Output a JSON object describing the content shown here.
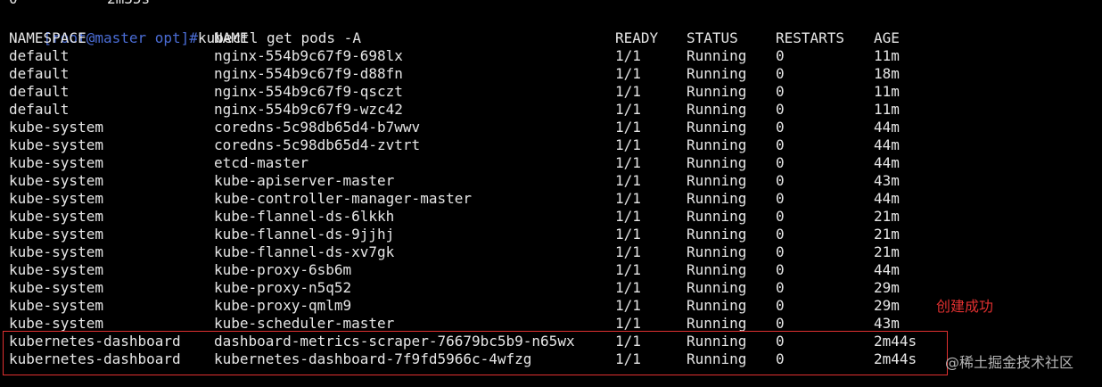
{
  "partial_top": {
    "col1": "0",
    "col2": "2m35s"
  },
  "prompt_text": "[root@master opt]#",
  "command": "kubectl get pods -A",
  "headers": {
    "namespace": "NAMESPACE",
    "name": "NAME",
    "ready": "READY",
    "status": "STATUS",
    "restarts": "RESTARTS",
    "age": "AGE"
  },
  "rows": [
    {
      "namespace": "default",
      "name": "nginx-554b9c67f9-698lx",
      "ready": "1/1",
      "status": "Running",
      "restarts": "0",
      "age": "11m"
    },
    {
      "namespace": "default",
      "name": "nginx-554b9c67f9-d88fn",
      "ready": "1/1",
      "status": "Running",
      "restarts": "0",
      "age": "18m"
    },
    {
      "namespace": "default",
      "name": "nginx-554b9c67f9-qsczt",
      "ready": "1/1",
      "status": "Running",
      "restarts": "0",
      "age": "11m"
    },
    {
      "namespace": "default",
      "name": "nginx-554b9c67f9-wzc42",
      "ready": "1/1",
      "status": "Running",
      "restarts": "0",
      "age": "11m"
    },
    {
      "namespace": "kube-system",
      "name": "coredns-5c98db65d4-b7wwv",
      "ready": "1/1",
      "status": "Running",
      "restarts": "0",
      "age": "44m"
    },
    {
      "namespace": "kube-system",
      "name": "coredns-5c98db65d4-zvtrt",
      "ready": "1/1",
      "status": "Running",
      "restarts": "0",
      "age": "44m"
    },
    {
      "namespace": "kube-system",
      "name": "etcd-master",
      "ready": "1/1",
      "status": "Running",
      "restarts": "0",
      "age": "44m"
    },
    {
      "namespace": "kube-system",
      "name": "kube-apiserver-master",
      "ready": "1/1",
      "status": "Running",
      "restarts": "0",
      "age": "43m"
    },
    {
      "namespace": "kube-system",
      "name": "kube-controller-manager-master",
      "ready": "1/1",
      "status": "Running",
      "restarts": "0",
      "age": "44m"
    },
    {
      "namespace": "kube-system",
      "name": "kube-flannel-ds-6lkkh",
      "ready": "1/1",
      "status": "Running",
      "restarts": "0",
      "age": "21m"
    },
    {
      "namespace": "kube-system",
      "name": "kube-flannel-ds-9jjhj",
      "ready": "1/1",
      "status": "Running",
      "restarts": "0",
      "age": "21m"
    },
    {
      "namespace": "kube-system",
      "name": "kube-flannel-ds-xv7gk",
      "ready": "1/1",
      "status": "Running",
      "restarts": "0",
      "age": "21m"
    },
    {
      "namespace": "kube-system",
      "name": "kube-proxy-6sb6m",
      "ready": "1/1",
      "status": "Running",
      "restarts": "0",
      "age": "44m"
    },
    {
      "namespace": "kube-system",
      "name": "kube-proxy-n5q52",
      "ready": "1/1",
      "status": "Running",
      "restarts": "0",
      "age": "29m"
    },
    {
      "namespace": "kube-system",
      "name": "kube-proxy-qmlm9",
      "ready": "1/1",
      "status": "Running",
      "restarts": "0",
      "age": "29m"
    },
    {
      "namespace": "kube-system",
      "name": "kube-scheduler-master",
      "ready": "1/1",
      "status": "Running",
      "restarts": "0",
      "age": "43m"
    },
    {
      "namespace": "kubernetes-dashboard",
      "name": "dashboard-metrics-scraper-76679bc5b9-n65wx",
      "ready": "1/1",
      "status": "Running",
      "restarts": "0",
      "age": "2m44s"
    },
    {
      "namespace": "kubernetes-dashboard",
      "name": "kubernetes-dashboard-7f9fd5966c-4wfzg",
      "ready": "1/1",
      "status": "Running",
      "restarts": "0",
      "age": "2m44s"
    }
  ],
  "annotation": "创建成功",
  "watermark": "@稀土掘金技术社区",
  "colors": {
    "background": "#000000",
    "text": "#e6e6e6",
    "prompt": "#4a6cd4",
    "highlight": "#e03030"
  }
}
